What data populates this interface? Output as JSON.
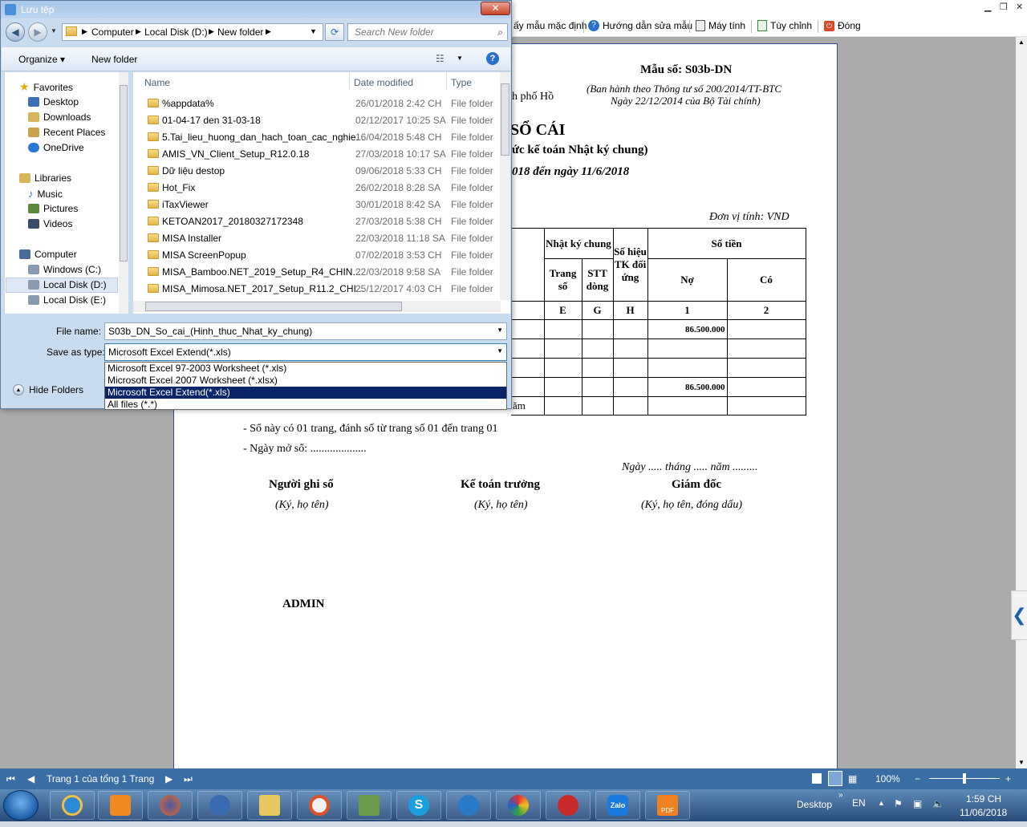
{
  "dialog": {
    "title": "Lưu tệp",
    "address": {
      "crumbs": [
        "Computer",
        "Local Disk (D:)",
        "New folder"
      ]
    },
    "search_placeholder": "Search New folder",
    "organize_label": "Organize ▾",
    "new_folder_label": "New folder",
    "nav": {
      "favorites": "Favorites",
      "desktop": "Desktop",
      "downloads": "Downloads",
      "recent": "Recent Places",
      "onedrive": "OneDrive",
      "libraries": "Libraries",
      "music": "Music",
      "pictures": "Pictures",
      "videos": "Videos",
      "computer": "Computer",
      "windows_c": "Windows (C:)",
      "local_d": "Local Disk (D:)",
      "local_e": "Local Disk (E:)"
    },
    "columns": {
      "name": "Name",
      "date": "Date modified",
      "type": "Type"
    },
    "files": [
      {
        "name": "%appdata%",
        "date": "26/01/2018 2:42 CH",
        "type": "File folder"
      },
      {
        "name": "01-04-17 den 31-03-18",
        "date": "02/12/2017 10:25 SA",
        "type": "File folder"
      },
      {
        "name": "5.Tai_lieu_huong_dan_hach_toan_cac_nghie...",
        "date": "16/04/2018 5:48 CH",
        "type": "File folder"
      },
      {
        "name": "AMIS_VN_Client_Setup_R12.0.18",
        "date": "27/03/2018 10:17 SA",
        "type": "File folder"
      },
      {
        "name": "Dữ liệu destop",
        "date": "09/06/2018 5:33 CH",
        "type": "File folder"
      },
      {
        "name": "Hot_Fix",
        "date": "26/02/2018 8:28 SA",
        "type": "File folder"
      },
      {
        "name": "iTaxViewer",
        "date": "30/01/2018 8:42 SA",
        "type": "File folder"
      },
      {
        "name": "KETOAN2017_20180327172348",
        "date": "27/03/2018 5:38 CH",
        "type": "File folder"
      },
      {
        "name": "MISA Installer",
        "date": "22/03/2018 11:18 SA",
        "type": "File folder"
      },
      {
        "name": "MISA ScreenPopup",
        "date": "07/02/2018 3:53 CH",
        "type": "File folder"
      },
      {
        "name": "MISA_Bamboo.NET_2019_Setup_R4_CHIN...",
        "date": "22/03/2018 9:58 SA",
        "type": "File folder"
      },
      {
        "name": "MISA_Mimosa.NET_2017_Setup_R11.2_CHI...",
        "date": "25/12/2017 4:03 CH",
        "type": "File folder"
      }
    ],
    "file_name_label": "File name:",
    "file_name_value": "S03b_DN_So_cai_(Hinh_thuc_Nhat_ky_chung)",
    "save_type_label": "Save as type:",
    "save_type_value": "Microsoft Excel Extend(*.xls)",
    "type_options": [
      "Microsoft Excel 97-2003 Worksheet (*.xls)",
      "Microsoft Excel 2007 Worksheet (*.xlsx)",
      "Microsoft Excel Extend(*.xls)",
      "All files (*.*)"
    ],
    "hide_folders": "Hide Folders"
  },
  "toolbar": {
    "default_template": "ấy mẫu mặc định",
    "edit_guide": "Hướng dẫn sửa mẫu",
    "calculator": "Máy tính",
    "customize": "Tùy chỉnh",
    "close": "Đóng"
  },
  "report": {
    "form_no": "Mẫu số: S03b-DN",
    "issued_1": "(Ban hành theo Thông tư số 200/2014/TT-BTC",
    "issued_2": "Ngày 22/12/2014 của Bộ Tài chính)",
    "city": "h phố Hồ",
    "title": "SỔ CÁI",
    "subtitle": "ức kế toán Nhật ký chung)",
    "period": "018 đến ngày 11/6/2018",
    "unit": "Đơn vị tính: VND",
    "headers": {
      "journal": "Nhật ký chung",
      "account": "Số hiệu TK đối ứng",
      "amount": "Số tiền",
      "page": "Trang số",
      "line": "STT dòng",
      "debit": "Nợ",
      "credit": "Có"
    },
    "codes": [
      "E",
      "G",
      "H",
      "1",
      "2"
    ],
    "rows": [
      {
        "debit": "86.500.000",
        "credit": ""
      },
      {
        "debit": "",
        "credit": ""
      },
      {
        "debit": "",
        "credit": ""
      },
      {
        "debit": "86.500.000",
        "credit": ""
      },
      {
        "debit": "",
        "credit": ""
      }
    ],
    "row5_frag": "ăm",
    "note_pages": "- Sổ này có 01 trang, đánh số từ trang số 01 đến trang 01",
    "note_open": "- Ngày mở sổ: ....................",
    "date_line": "Ngày ..... tháng ..... năm .........",
    "sign": [
      {
        "role": "Người ghi sổ",
        "hint": "(Ký, họ tên)"
      },
      {
        "role": "Kế toán trưởng",
        "hint": "(Ký, họ tên)"
      },
      {
        "role": "Giám đốc",
        "hint": "(Ký, họ tên, đóng dấu)"
      }
    ],
    "preparer": "ADMIN"
  },
  "statusbar": {
    "page_info": "Trang 1 của tổng 1 Trang",
    "zoom": "100%"
  },
  "taskbar": {
    "desktop": "Desktop",
    "lang": "EN",
    "time": "1:59 CH",
    "date": "11/06/2018",
    "zalo": "Zalo",
    "pdf": "PDF"
  },
  "colors": {
    "accent": "#3a6ea5",
    "selection": "#0a246a",
    "page_border": "#2b4e8f"
  }
}
